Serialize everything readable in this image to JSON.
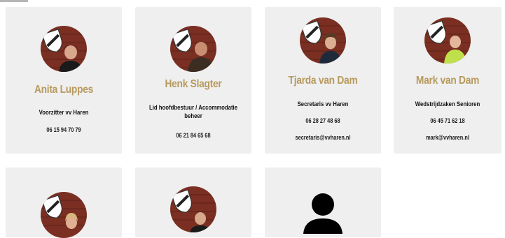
{
  "accent_color": "#b79a5e",
  "staff": [
    {
      "name": "Anita Luppes",
      "role": "Voorzitter vv Haren",
      "phone": "06 15 94 70 79",
      "email": ""
    },
    {
      "name": "Henk Slagter",
      "role": "Lid hoofdbestuur / Accommodatie beheer",
      "phone": "06 21 84 65 68",
      "email": ""
    },
    {
      "name": "Tjarda van Dam",
      "role": "Secretaris vv Haren",
      "phone": "06 28 27 48 68",
      "email": "secretaris@vvharen.nl"
    },
    {
      "name": "Mark van Dam",
      "role": "Wedstrijdzaken Senioren",
      "phone": "06 45 71 62 18",
      "email": "mark@vvharen.nl"
    },
    {
      "name": "",
      "role": "",
      "phone": "",
      "email": ""
    },
    {
      "name": "",
      "role": "",
      "phone": "",
      "email": ""
    },
    {
      "name": "",
      "role": "",
      "phone": "",
      "email": "",
      "placeholder_icon": "person-silhouette-icon"
    }
  ]
}
